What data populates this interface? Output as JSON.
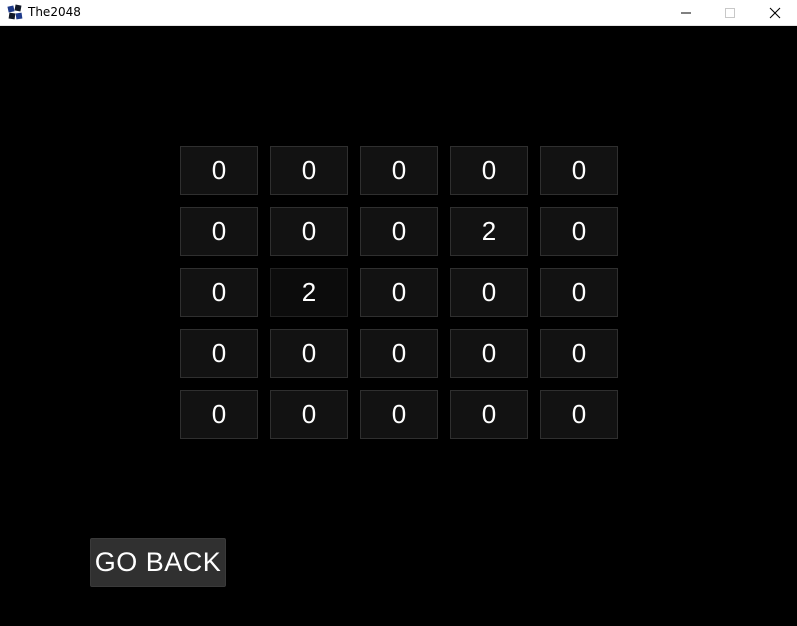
{
  "window": {
    "title": "The2048",
    "icon": "app-logo-icon",
    "controls": [
      "minimize-icon",
      "maximize-icon",
      "close-icon"
    ]
  },
  "grid": {
    "rows": [
      [
        "0",
        "0",
        "0",
        "0",
        "0"
      ],
      [
        "0",
        "0",
        "0",
        "2",
        "0"
      ],
      [
        "0",
        "2",
        "0",
        "0",
        "0"
      ],
      [
        "0",
        "0",
        "0",
        "0",
        "0"
      ],
      [
        "0",
        "0",
        "0",
        "0",
        "0"
      ]
    ]
  },
  "buttons": {
    "go_back": "GO BACK"
  },
  "colors": {
    "background": "#000000",
    "tile_bg": "#121212",
    "tile_border": "#2f2f2f",
    "button_bg": "#303030",
    "text": "#ffffff"
  }
}
